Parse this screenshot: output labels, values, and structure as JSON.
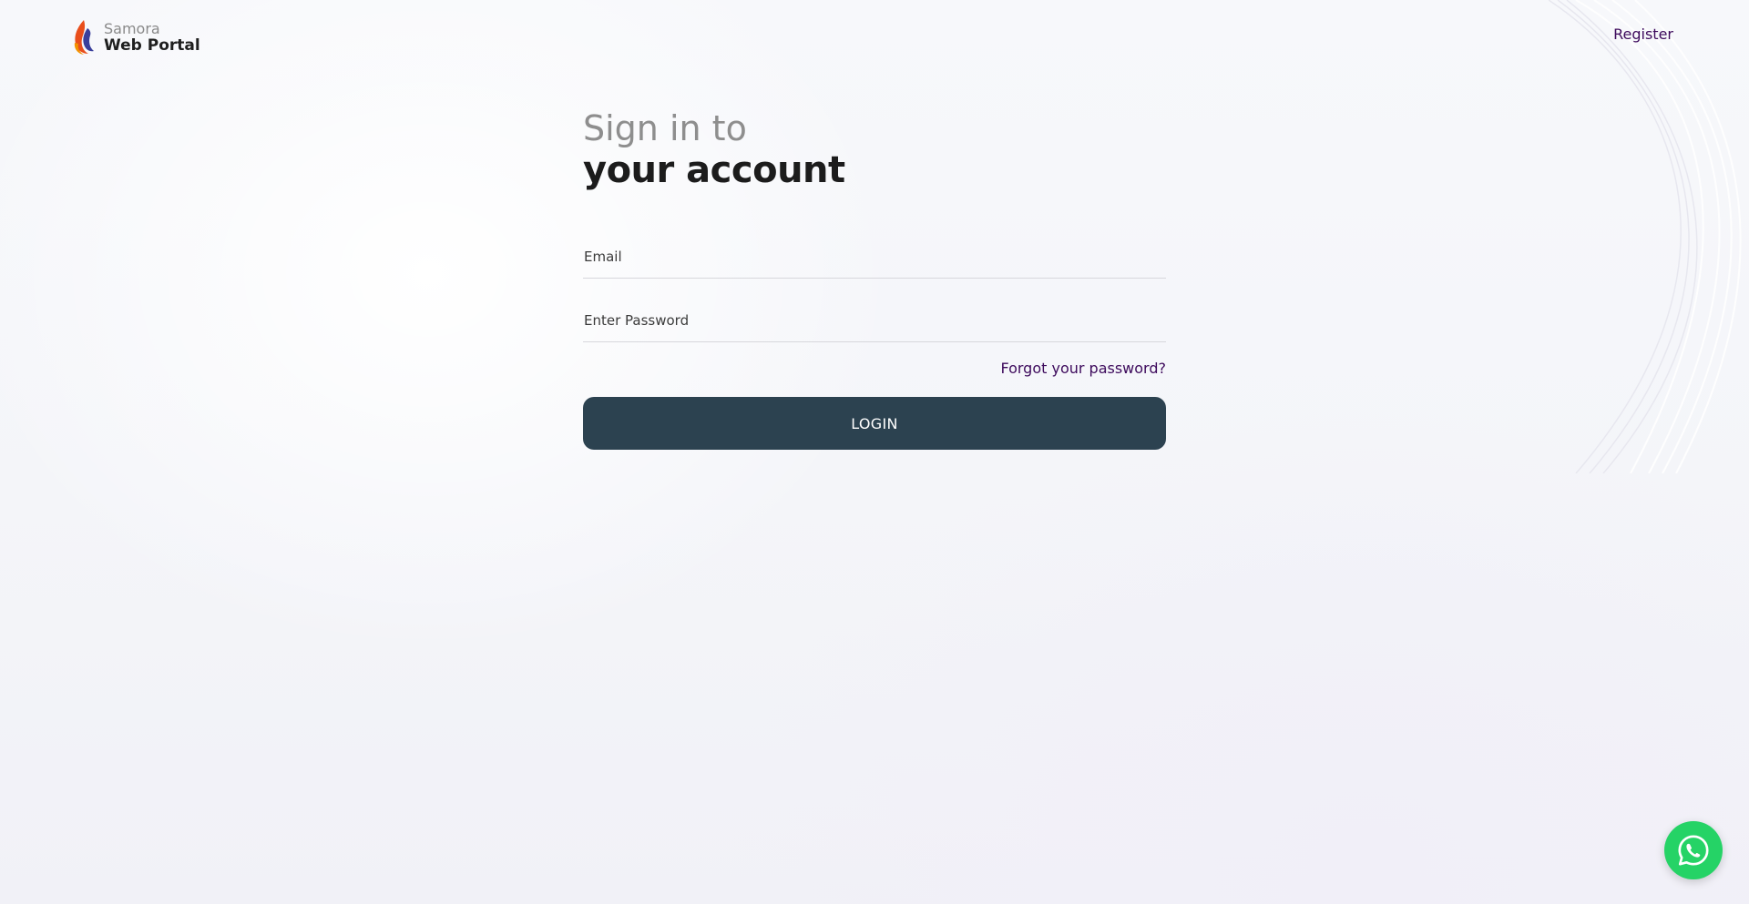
{
  "brand": {
    "top_label": "Samora",
    "bottom_label": "Web Portal",
    "logo_icon": "flame-logo-icon"
  },
  "header": {
    "register_label": "Register"
  },
  "login": {
    "title_line1": "Sign in to",
    "title_line2": "your account",
    "email": {
      "value": "",
      "placeholder": "Email"
    },
    "password": {
      "value": "",
      "placeholder": "Enter Password"
    },
    "forgot_label": "Forgot your password?",
    "submit_label": "LOGIN"
  },
  "chat_widget": {
    "icon": "whatsapp-icon"
  },
  "colors": {
    "accent_link": "#3d0a5c",
    "button_bg": "#2c4250",
    "chat_green": "#25d366"
  }
}
